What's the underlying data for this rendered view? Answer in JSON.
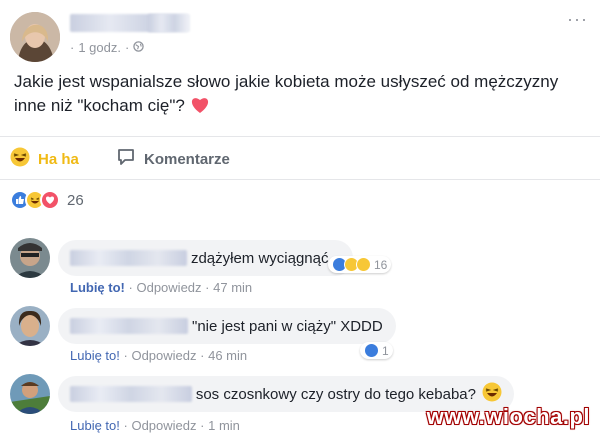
{
  "post": {
    "timestamp": "1 godz.",
    "separator": "·",
    "text_line1": "Jakie jest wspanialsze słowo jakie kobieta może usłyszeć od mężczyzny",
    "text_line2": "inne niż \"kocham cię\"?",
    "more_icon": "more-dots-icon",
    "privacy_icon": "globe-icon"
  },
  "actions": {
    "reaction_label": "Ha ha",
    "comment_label": "Komentarze",
    "haha_color": "#f0ba15"
  },
  "reactions": {
    "icons": [
      "like-icon",
      "haha-icon",
      "love-icon"
    ],
    "count": "26"
  },
  "comments": [
    {
      "text": "zdążyłem wyciągnąć...",
      "like_label": "Lubię to!",
      "reply_label": "Odpowiedz",
      "time": "47 min",
      "reaction_count": "16",
      "liked": true
    },
    {
      "text": "\"nie jest pani w ciąży\" XDDD",
      "like_label": "Lubię to!",
      "reply_label": "Odpowiedz",
      "time": "46 min",
      "reaction_count": "1",
      "liked": false
    },
    {
      "text": "sos czosnkowy czy ostry do tego kebaba?",
      "like_label": "Lubię to!",
      "reply_label": "Odpowiedz",
      "time": "1 min",
      "liked": false
    }
  ],
  "separator_dot": "·",
  "watermark": "www.wiocha.pl",
  "colors": {
    "link_blue": "#4267b2",
    "meta_gray": "#90949c",
    "bubble_bg": "#f2f3f5"
  }
}
